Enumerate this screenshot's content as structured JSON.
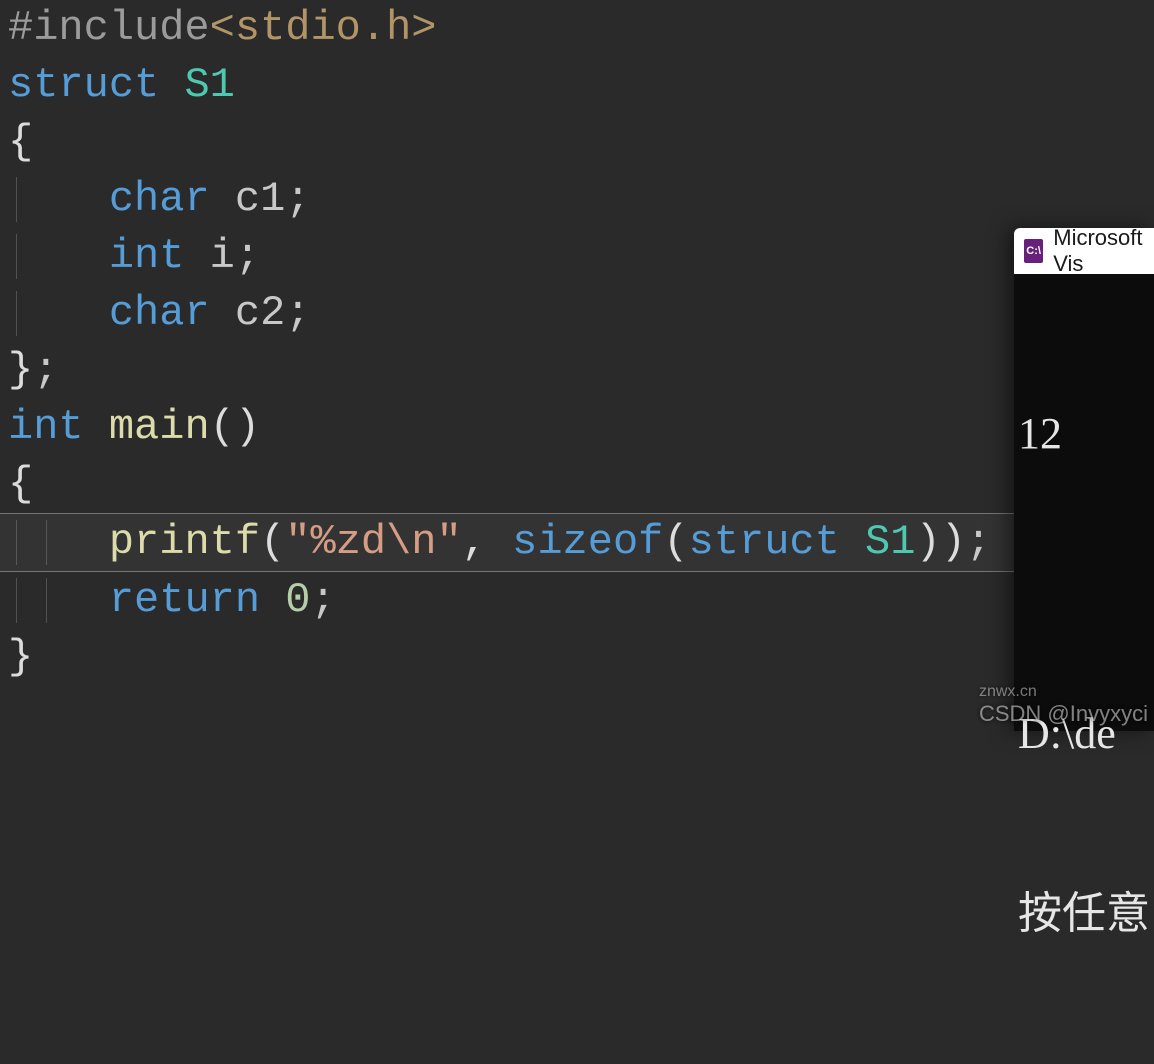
{
  "code": {
    "line1": {
      "preproc": "#include",
      "open": "<",
      "path": "stdio.h",
      "close": ">"
    },
    "line2": {
      "kw": "struct",
      "sp": " ",
      "name": "S1"
    },
    "line3": {
      "brace": "{"
    },
    "line4": {
      "indent": "    ",
      "kw": "char",
      "sp": " ",
      "ident": "c1",
      "semi": ";"
    },
    "line5": {
      "indent": "    ",
      "kw": "int",
      "sp": " ",
      "ident": "i",
      "semi": ";"
    },
    "line6": {
      "indent": "    ",
      "kw": "char",
      "sp": " ",
      "ident": "c2",
      "semi": ";"
    },
    "line7": {
      "brace": "}",
      "semi": ";"
    },
    "line8": {
      "kw": "int",
      "sp": " ",
      "fn": "main",
      "parens": "()"
    },
    "line9": {
      "brace": "{"
    },
    "line10": {
      "indent": "    ",
      "fn": "printf",
      "open": "(",
      "str": "\"%zd\\n\"",
      "comma": ", ",
      "kw_sizeof": "sizeof",
      "open2": "(",
      "kw_struct": "struct",
      "sp2": " ",
      "name": "S1",
      "close2": ")",
      "close": ")",
      "semi": ";"
    },
    "line11": {
      "indent": "    ",
      "kw": "return",
      "sp": " ",
      "num": "0",
      "semi": ";"
    },
    "line12": {
      "brace": "}"
    }
  },
  "console": {
    "title": "Microsoft Vis",
    "icon_label": "C:\\",
    "output_value": "12",
    "blank": "",
    "path_line": "D:\\de",
    "prompt_line": "按任意"
  },
  "watermark": {
    "top": "znwx.cn",
    "bottom": "CSDN @Invyxyci"
  }
}
